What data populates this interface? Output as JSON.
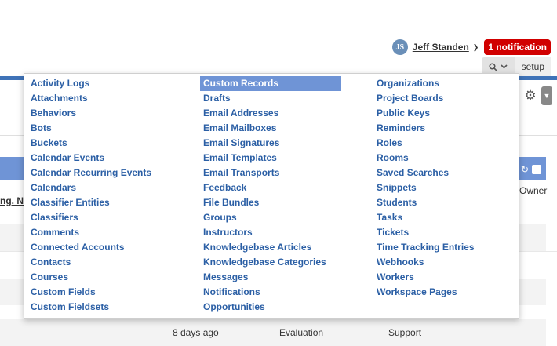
{
  "user": {
    "initials": "JS",
    "name": "Jeff Standen",
    "notifications": "1 notification"
  },
  "topnav": {
    "search_icon": "search-icon",
    "setup": "setup"
  },
  "worklist": {
    "column_left": "ng. N",
    "column_right": "Owner"
  },
  "bottom_row": {
    "updated": "8 days ago",
    "status": "Evaluation",
    "group": "Support"
  },
  "menu": {
    "columns": [
      [
        "Activity Logs",
        "Attachments",
        "Behaviors",
        "Bots",
        "Buckets",
        "Calendar Events",
        "Calendar Recurring Events",
        "Calendars",
        "Classifier Entities",
        "Classifiers",
        "Comments",
        "Connected Accounts",
        "Contacts",
        "Courses",
        "Custom Fields",
        "Custom Fieldsets"
      ],
      [
        "Custom Records",
        "Drafts",
        "Email Addresses",
        "Email Mailboxes",
        "Email Signatures",
        "Email Templates",
        "Email Transports",
        "Feedback",
        "File Bundles",
        "Groups",
        "Instructors",
        "Knowledgebase Articles",
        "Knowledgebase Categories",
        "Messages",
        "Notifications",
        "Opportunities"
      ],
      [
        "Organizations",
        "Project Boards",
        "Public Keys",
        "Reminders",
        "Roles",
        "Rooms",
        "Saved Searches",
        "Snippets",
        "Students",
        "Tasks",
        "Tickets",
        "Time Tracking Entries",
        "Webhooks",
        "Workers",
        "Workspace Pages"
      ]
    ],
    "active": "Custom Records"
  },
  "colors": {
    "accent": "#3f73b8",
    "menu_link": "#2b5fa5",
    "highlight": "#6f94d6",
    "notification": "#d10000"
  }
}
